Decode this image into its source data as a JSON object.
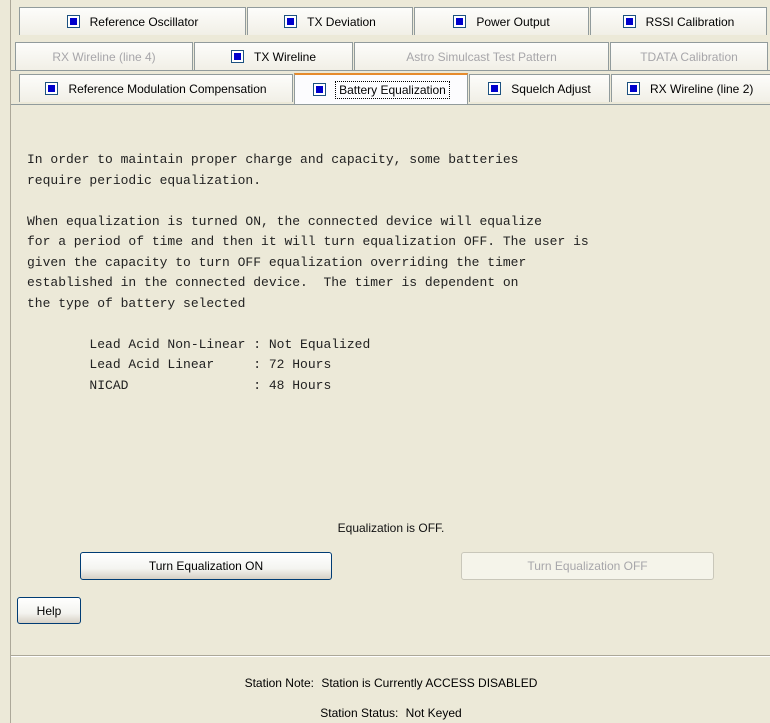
{
  "tabs": {
    "row1": [
      {
        "label": "Reference Oscillator",
        "checked": true,
        "enabled": true
      },
      {
        "label": "TX Deviation",
        "checked": true,
        "enabled": true
      },
      {
        "label": "Power Output",
        "checked": true,
        "enabled": true
      },
      {
        "label": "RSSI Calibration",
        "checked": true,
        "enabled": true
      }
    ],
    "row2": [
      {
        "label": "RX Wireline (line 4)",
        "checked": false,
        "enabled": false
      },
      {
        "label": "TX Wireline",
        "checked": true,
        "enabled": true
      },
      {
        "label": "Astro Simulcast Test Pattern",
        "checked": false,
        "enabled": false
      },
      {
        "label": "TDATA Calibration",
        "checked": false,
        "enabled": false
      }
    ],
    "row3": [
      {
        "label": "Reference Modulation Compensation",
        "checked": true,
        "enabled": true
      },
      {
        "label": "Battery Equalization",
        "checked": true,
        "enabled": true,
        "selected": true
      },
      {
        "label": "Squelch Adjust",
        "checked": true,
        "enabled": true
      },
      {
        "label": "RX Wireline (line 2)",
        "checked": true,
        "enabled": true
      }
    ]
  },
  "content": {
    "text": "In order to maintain proper charge and capacity, some batteries\nrequire periodic equalization.\n\nWhen equalization is turned ON, the connected device will equalize\nfor a period of time and then it will turn equalization OFF. The user is\ngiven the capacity to turn OFF equalization overriding the timer\nestablished in the connected device.  The timer is dependent on\nthe type of battery selected\n\n        Lead Acid Non-Linear : Not Equalized\n        Lead Acid Linear     : 72 Hours\n        NICAD                : 48 Hours"
  },
  "status": {
    "equalization_text": "Equalization is OFF."
  },
  "buttons": {
    "turn_on": "Turn Equalization ON",
    "turn_off": "Turn Equalization OFF",
    "help": "Help"
  },
  "footer": {
    "station_note_label": "Station Note:",
    "station_note_value": "Station is Currently ACCESS DISABLED",
    "station_status_label": "Station Status:",
    "station_status_value": "Not Keyed"
  }
}
